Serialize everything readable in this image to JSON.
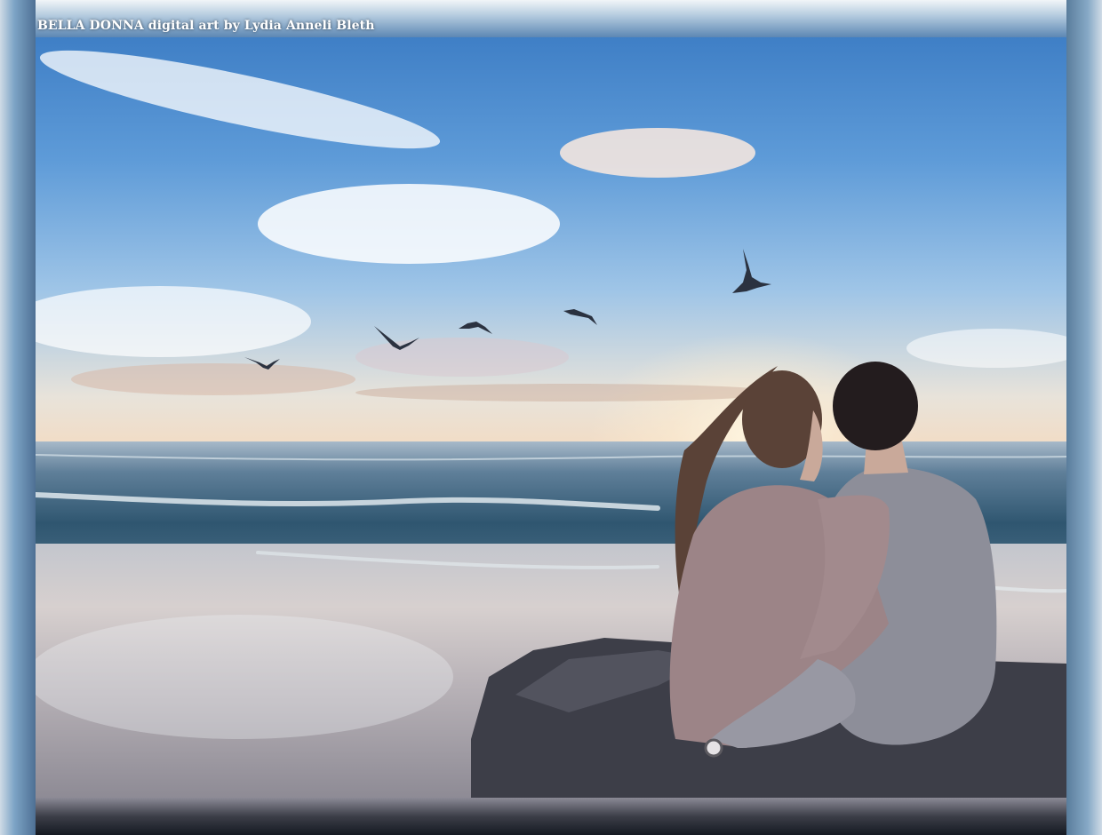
{
  "watermark": {
    "text": "BELLA DONNA digital art by Lydia Anneli Bleth"
  },
  "colors": {
    "sky_top": "#3f7fc6",
    "horizon": "#f2dcc5",
    "sea": "#2f5670",
    "sand": "#c3c6cd",
    "rock": "#3a3b44",
    "sweater_woman": "#9c8487",
    "sweater_man": "#8e8f99",
    "hair_man": "#1f1a1c",
    "hair_woman": "#5a4237"
  },
  "scene": {
    "subjects": [
      "couple-kissing",
      "seagulls",
      "ocean-waves",
      "sunset-sky",
      "beach",
      "rock"
    ]
  }
}
